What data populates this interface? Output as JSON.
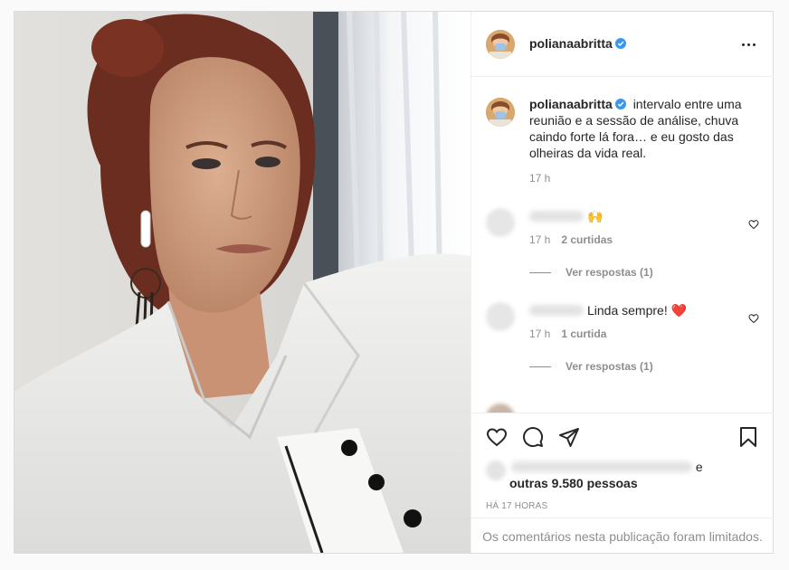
{
  "post": {
    "username": "polianaabritta",
    "caption": "intervalo entre uma reunião e a sessão de análise, chuva caindo forte lá fora… e eu gosto das olheiras da vida real.",
    "caption_time": "17 h"
  },
  "comments": [
    {
      "text": "🙌",
      "time": "17 h",
      "likes": "2 curtidas",
      "replies": "Ver respostas (1)"
    },
    {
      "text": "Linda sempre! ❤️",
      "time": "17 h",
      "likes": "1 curtida",
      "replies": "Ver respostas (1)"
    }
  ],
  "likes": {
    "connector": "e",
    "others": "outras 9.580 pessoas"
  },
  "time_ago": "HÁ 17 HORAS",
  "comments_limited": "Os comentários nesta publicação foram limitados.",
  "colors": {
    "verified": "#3897f0",
    "text": "#262626",
    "secondary": "#8e8e8e",
    "border": "#dbdbdb"
  },
  "icons": [
    "more-icon",
    "verified-icon",
    "heart-icon",
    "comment-icon",
    "share-icon",
    "bookmark-icon",
    "small-heart-icon"
  ]
}
